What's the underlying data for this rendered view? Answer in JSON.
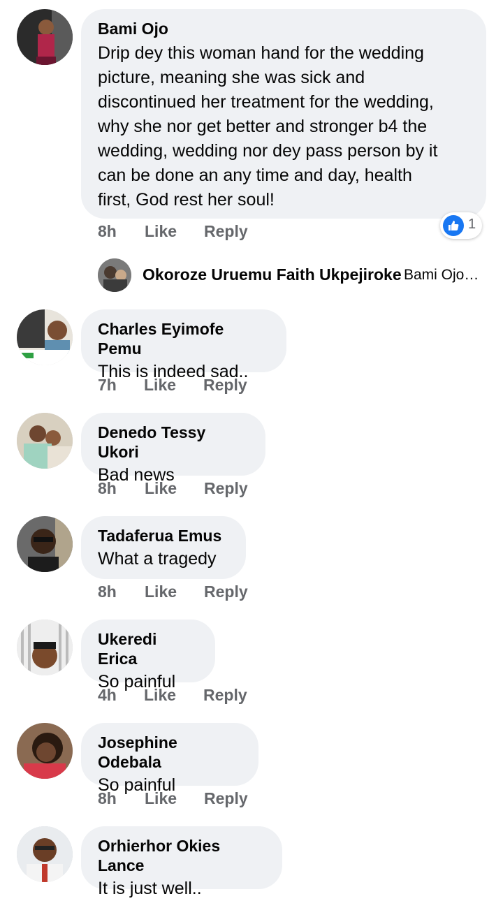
{
  "comments": [
    {
      "author": "Bami Ojo",
      "lines": [
        "Drip dey this woman hand for the wedding",
        "picture, meaning she was sick and",
        "discontinued her treatment for the wedding,",
        "why she nor get better and stronger b4 the",
        "wedding, wedding nor dey pass person by it",
        "can be done an any time and day, health",
        "first, God rest her soul!"
      ],
      "time": "8h",
      "like": "Like",
      "reply": "Reply",
      "reaction_count": "1",
      "reply_author": "Okoroze Uruemu Faith Ukpejiroke",
      "reply_preview": "Bami Ojo…"
    },
    {
      "author": "Charles Eyimofe Pemu",
      "text": "This is indeed sad..",
      "time": "7h",
      "like": "Like",
      "reply": "Reply"
    },
    {
      "author": "Denedo Tessy Ukori",
      "text": "Bad news",
      "time": "8h",
      "like": "Like",
      "reply": "Reply"
    },
    {
      "author": "Tadaferua Emus",
      "text": "What a tragedy",
      "time": "8h",
      "like": "Like",
      "reply": "Reply"
    },
    {
      "author": "Ukeredi Erica",
      "text": "So painful",
      "time": "4h",
      "like": "Like",
      "reply": "Reply"
    },
    {
      "author": "Josephine Odebala",
      "text": "So painful",
      "time": "8h",
      "like": "Like",
      "reply": "Reply"
    },
    {
      "author": "Orhierhor Okies Lance",
      "text": "It is just well..",
      "time": "",
      "like": "",
      "reply": ""
    }
  ],
  "colors": {
    "bubble": "#eff1f4",
    "meta": "#65676b",
    "like_blue": "#1877f2"
  },
  "icons": {
    "reaction": "thumbs-up-icon"
  }
}
